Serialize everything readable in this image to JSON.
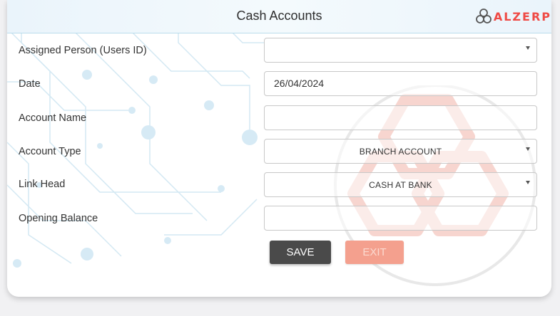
{
  "header": {
    "title": "Cash Accounts"
  },
  "brand": {
    "logo_text": "ALZERP",
    "accent_color": "#ef4a45"
  },
  "form": {
    "assigned_person": {
      "label": "Assigned Person (Users ID)",
      "value": ""
    },
    "date": {
      "label": "Date",
      "value": "26/04/2024"
    },
    "account_name": {
      "label": "Account Name",
      "value": ""
    },
    "account_type": {
      "label": "Account Type",
      "value": "BRANCH ACCOUNT"
    },
    "link_head": {
      "label": "Link Head",
      "value": "CASH AT BANK"
    },
    "opening_balance": {
      "label": "Opening Balance",
      "value": ""
    }
  },
  "actions": {
    "save_label": "SAVE",
    "exit_label": "EXIT"
  },
  "icons": {
    "dropdown": "chevron-down-icon",
    "logo": "alzerp-logo-icon"
  }
}
